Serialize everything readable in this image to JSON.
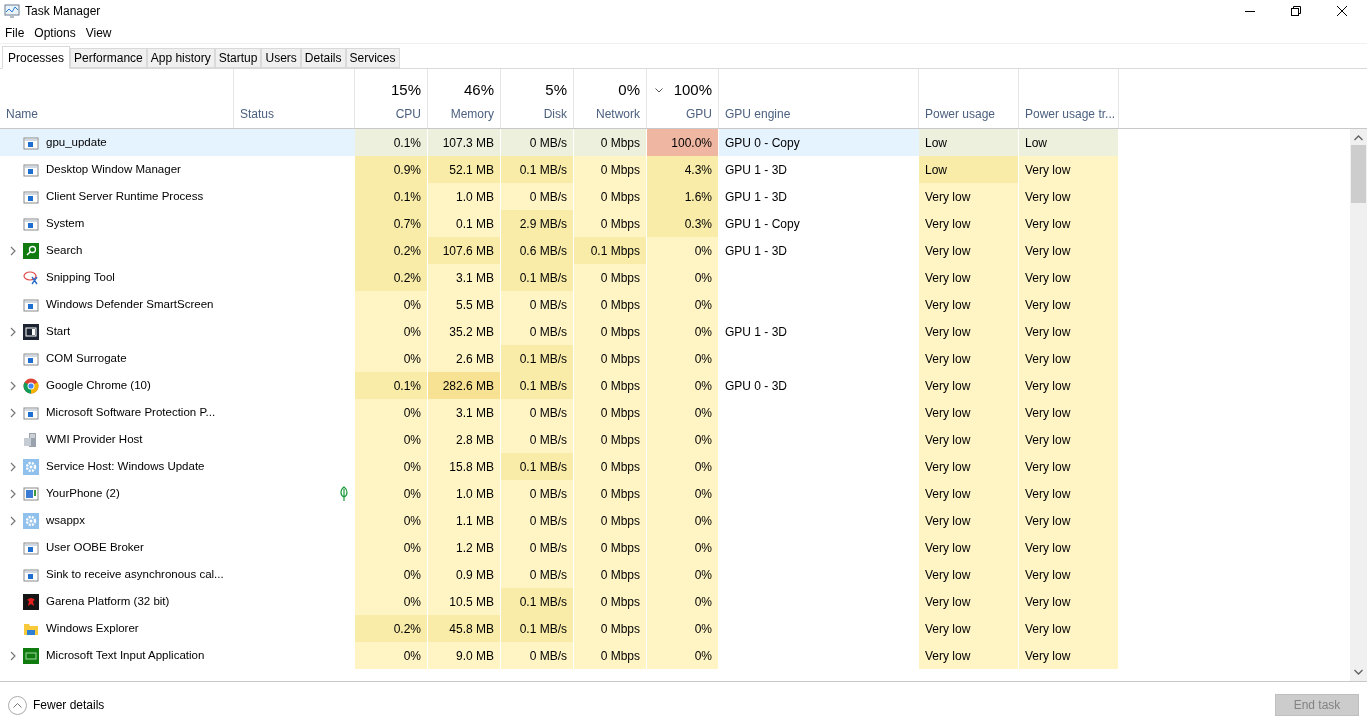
{
  "window": {
    "title": "Task Manager"
  },
  "menu": [
    "File",
    "Options",
    "View"
  ],
  "tabs": [
    {
      "label": "Processes",
      "selected": true
    },
    {
      "label": "Performance",
      "selected": false
    },
    {
      "label": "App history",
      "selected": false
    },
    {
      "label": "Startup",
      "selected": false
    },
    {
      "label": "Users",
      "selected": false
    },
    {
      "label": "Details",
      "selected": false
    },
    {
      "label": "Services",
      "selected": false
    }
  ],
  "table": {
    "columns": [
      {
        "label": "Name",
        "sorted": false
      },
      {
        "label": "Status",
        "sorted": false
      },
      {
        "label": "CPU",
        "summary": "15%",
        "sorted": false
      },
      {
        "label": "Memory",
        "summary": "46%",
        "sorted": false
      },
      {
        "label": "Disk",
        "summary": "5%",
        "sorted": false
      },
      {
        "label": "Network",
        "summary": "0%",
        "sorted": false
      },
      {
        "label": "GPU",
        "summary": "100%",
        "sorted": true
      },
      {
        "label": "GPU engine",
        "sorted": false
      },
      {
        "label": "Power usage",
        "sorted": false
      },
      {
        "label": "Power usage tr...",
        "sorted": false
      }
    ],
    "rows": [
      {
        "kind": "app",
        "expandable": false,
        "selected": true,
        "status_leaf": false,
        "cells": [
          {
            "text": "gpu_update"
          },
          {
            "text": ""
          },
          {
            "text": "0.1%",
            "color": "#edf0dc"
          },
          {
            "text": "107.3 MB",
            "color": "#edf0dc"
          },
          {
            "text": "0 MB/s",
            "color": "#edf0dc"
          },
          {
            "text": "0 Mbps",
            "color": "#edf0dc"
          },
          {
            "text": "100.0%",
            "color": "#efb6a2"
          },
          {
            "text": "GPU 0 - Copy"
          },
          {
            "text": "Low",
            "color": "#edf0dc"
          },
          {
            "text": "Low",
            "color": "#edf0dc"
          }
        ]
      },
      {
        "kind": "app",
        "expandable": false,
        "selected": false,
        "status_leaf": false,
        "cells": [
          {
            "text": "Desktop Window Manager"
          },
          {
            "text": ""
          },
          {
            "text": "0.9%",
            "color": "#f9eca8"
          },
          {
            "text": "52.1 MB",
            "color": "#f9eca8"
          },
          {
            "text": "0.1 MB/s",
            "color": "#f9eca8"
          },
          {
            "text": "0 Mbps",
            "color": "#fff4c4"
          },
          {
            "text": "4.3%",
            "color": "#f9eca8"
          },
          {
            "text": "GPU 1 - 3D"
          },
          {
            "text": "Low",
            "color": "#f9eca8"
          },
          {
            "text": "Very low",
            "color": "#fff4c4"
          }
        ]
      },
      {
        "kind": "app",
        "expandable": false,
        "selected": false,
        "status_leaf": false,
        "cells": [
          {
            "text": "Client Server Runtime Process"
          },
          {
            "text": ""
          },
          {
            "text": "0.1%",
            "color": "#f9eca8"
          },
          {
            "text": "1.0 MB",
            "color": "#fff4c4"
          },
          {
            "text": "0 MB/s",
            "color": "#fff4c4"
          },
          {
            "text": "0 Mbps",
            "color": "#fff4c4"
          },
          {
            "text": "1.6%",
            "color": "#f9eca8"
          },
          {
            "text": "GPU 1 - 3D"
          },
          {
            "text": "Very low",
            "color": "#fff4c4"
          },
          {
            "text": "Very low",
            "color": "#fff4c4"
          }
        ]
      },
      {
        "kind": "app",
        "expandable": false,
        "selected": false,
        "status_leaf": false,
        "cells": [
          {
            "text": "System"
          },
          {
            "text": ""
          },
          {
            "text": "0.7%",
            "color": "#f9eca8"
          },
          {
            "text": "0.1 MB",
            "color": "#fff4c4"
          },
          {
            "text": "2.9 MB/s",
            "color": "#f9eca8"
          },
          {
            "text": "0 Mbps",
            "color": "#fff4c4"
          },
          {
            "text": "0.3%",
            "color": "#f9eca8"
          },
          {
            "text": "GPU 1 - Copy"
          },
          {
            "text": "Very low",
            "color": "#fff4c4"
          },
          {
            "text": "Very low",
            "color": "#fff4c4"
          }
        ]
      },
      {
        "kind": "search",
        "expandable": true,
        "selected": false,
        "status_leaf": false,
        "cells": [
          {
            "text": "Search"
          },
          {
            "text": ""
          },
          {
            "text": "0.2%",
            "color": "#f9eca8"
          },
          {
            "text": "107.6 MB",
            "color": "#f9eca8"
          },
          {
            "text": "0.6 MB/s",
            "color": "#f9eca8"
          },
          {
            "text": "0.1 Mbps",
            "color": "#f9eca8"
          },
          {
            "text": "0%",
            "color": "#fff4c4"
          },
          {
            "text": "GPU 1 - 3D"
          },
          {
            "text": "Very low",
            "color": "#fff4c4"
          },
          {
            "text": "Very low",
            "color": "#fff4c4"
          }
        ]
      },
      {
        "kind": "scissors",
        "expandable": false,
        "selected": false,
        "status_leaf": false,
        "cells": [
          {
            "text": "Snipping Tool"
          },
          {
            "text": ""
          },
          {
            "text": "0.2%",
            "color": "#f9eca8"
          },
          {
            "text": "3.1 MB",
            "color": "#fff4c4"
          },
          {
            "text": "0.1 MB/s",
            "color": "#f9eca8"
          },
          {
            "text": "0 Mbps",
            "color": "#fff4c4"
          },
          {
            "text": "0%",
            "color": "#fff4c4"
          },
          {
            "text": ""
          },
          {
            "text": "Very low",
            "color": "#fff4c4"
          },
          {
            "text": "Very low",
            "color": "#fff4c4"
          }
        ]
      },
      {
        "kind": "app",
        "expandable": false,
        "selected": false,
        "status_leaf": false,
        "cells": [
          {
            "text": "Windows Defender SmartScreen"
          },
          {
            "text": ""
          },
          {
            "text": "0%",
            "color": "#fff4c4"
          },
          {
            "text": "5.5 MB",
            "color": "#fff4c4"
          },
          {
            "text": "0 MB/s",
            "color": "#fff4c4"
          },
          {
            "text": "0 Mbps",
            "color": "#fff4c4"
          },
          {
            "text": "0%",
            "color": "#fff4c4"
          },
          {
            "text": ""
          },
          {
            "text": "Very low",
            "color": "#fff4c4"
          },
          {
            "text": "Very low",
            "color": "#fff4c4"
          }
        ]
      },
      {
        "kind": "start",
        "expandable": true,
        "selected": false,
        "status_leaf": false,
        "cells": [
          {
            "text": "Start"
          },
          {
            "text": ""
          },
          {
            "text": "0%",
            "color": "#fff4c4"
          },
          {
            "text": "35.2 MB",
            "color": "#fff4c4"
          },
          {
            "text": "0 MB/s",
            "color": "#fff4c4"
          },
          {
            "text": "0 Mbps",
            "color": "#fff4c4"
          },
          {
            "text": "0%",
            "color": "#fff4c4"
          },
          {
            "text": "GPU 1 - 3D"
          },
          {
            "text": "Very low",
            "color": "#fff4c4"
          },
          {
            "text": "Very low",
            "color": "#fff4c4"
          }
        ]
      },
      {
        "kind": "app",
        "expandable": false,
        "selected": false,
        "status_leaf": false,
        "cells": [
          {
            "text": "COM Surrogate"
          },
          {
            "text": ""
          },
          {
            "text": "0%",
            "color": "#fff4c4"
          },
          {
            "text": "2.6 MB",
            "color": "#fff4c4"
          },
          {
            "text": "0.1 MB/s",
            "color": "#f9eca8"
          },
          {
            "text": "0 Mbps",
            "color": "#fff4c4"
          },
          {
            "text": "0%",
            "color": "#fff4c4"
          },
          {
            "text": ""
          },
          {
            "text": "Very low",
            "color": "#fff4c4"
          },
          {
            "text": "Very low",
            "color": "#fff4c4"
          }
        ]
      },
      {
        "kind": "chrome",
        "expandable": true,
        "selected": false,
        "status_leaf": false,
        "cells": [
          {
            "text": "Google Chrome (10)"
          },
          {
            "text": ""
          },
          {
            "text": "0.1%",
            "color": "#f9eca8"
          },
          {
            "text": "282.6 MB",
            "color": "#f7e193"
          },
          {
            "text": "0.1 MB/s",
            "color": "#f9eca8"
          },
          {
            "text": "0 Mbps",
            "color": "#fff4c4"
          },
          {
            "text": "0%",
            "color": "#fff4c4"
          },
          {
            "text": "GPU 0 - 3D"
          },
          {
            "text": "Very low",
            "color": "#fff4c4"
          },
          {
            "text": "Very low",
            "color": "#fff4c4"
          }
        ]
      },
      {
        "kind": "app",
        "expandable": true,
        "selected": false,
        "status_leaf": false,
        "cells": [
          {
            "text": "Microsoft Software Protection P..."
          },
          {
            "text": ""
          },
          {
            "text": "0%",
            "color": "#fff4c4"
          },
          {
            "text": "3.1 MB",
            "color": "#fff4c4"
          },
          {
            "text": "0 MB/s",
            "color": "#fff4c4"
          },
          {
            "text": "0 Mbps",
            "color": "#fff4c4"
          },
          {
            "text": "0%",
            "color": "#fff4c4"
          },
          {
            "text": ""
          },
          {
            "text": "Very low",
            "color": "#fff4c4"
          },
          {
            "text": "Very low",
            "color": "#fff4c4"
          }
        ]
      },
      {
        "kind": "wmi",
        "expandable": false,
        "selected": false,
        "status_leaf": false,
        "cells": [
          {
            "text": "WMI Provider Host"
          },
          {
            "text": ""
          },
          {
            "text": "0%",
            "color": "#fff4c4"
          },
          {
            "text": "2.8 MB",
            "color": "#fff4c4"
          },
          {
            "text": "0 MB/s",
            "color": "#fff4c4"
          },
          {
            "text": "0 Mbps",
            "color": "#fff4c4"
          },
          {
            "text": "0%",
            "color": "#fff4c4"
          },
          {
            "text": ""
          },
          {
            "text": "Very low",
            "color": "#fff4c4"
          },
          {
            "text": "Very low",
            "color": "#fff4c4"
          }
        ]
      },
      {
        "kind": "gear",
        "expandable": true,
        "selected": false,
        "status_leaf": false,
        "cells": [
          {
            "text": "Service Host: Windows Update"
          },
          {
            "text": ""
          },
          {
            "text": "0%",
            "color": "#fff4c4"
          },
          {
            "text": "15.8 MB",
            "color": "#fff4c4"
          },
          {
            "text": "0.1 MB/s",
            "color": "#f9eca8"
          },
          {
            "text": "0 Mbps",
            "color": "#fff4c4"
          },
          {
            "text": "0%",
            "color": "#fff4c4"
          },
          {
            "text": ""
          },
          {
            "text": "Very low",
            "color": "#fff4c4"
          },
          {
            "text": "Very low",
            "color": "#fff4c4"
          }
        ]
      },
      {
        "kind": "phone",
        "expandable": true,
        "selected": false,
        "status_leaf": true,
        "cells": [
          {
            "text": "YourPhone (2)"
          },
          {
            "text": ""
          },
          {
            "text": "0%",
            "color": "#fff4c4"
          },
          {
            "text": "1.0 MB",
            "color": "#fff4c4"
          },
          {
            "text": "0 MB/s",
            "color": "#fff4c4"
          },
          {
            "text": "0 Mbps",
            "color": "#fff4c4"
          },
          {
            "text": "0%",
            "color": "#fff4c4"
          },
          {
            "text": ""
          },
          {
            "text": "Very low",
            "color": "#fff4c4"
          },
          {
            "text": "Very low",
            "color": "#fff4c4"
          }
        ]
      },
      {
        "kind": "gear",
        "expandable": true,
        "selected": false,
        "status_leaf": false,
        "cells": [
          {
            "text": "wsappx"
          },
          {
            "text": ""
          },
          {
            "text": "0%",
            "color": "#fff4c4"
          },
          {
            "text": "1.1 MB",
            "color": "#fff4c4"
          },
          {
            "text": "0 MB/s",
            "color": "#fff4c4"
          },
          {
            "text": "0 Mbps",
            "color": "#fff4c4"
          },
          {
            "text": "0%",
            "color": "#fff4c4"
          },
          {
            "text": ""
          },
          {
            "text": "Very low",
            "color": "#fff4c4"
          },
          {
            "text": "Very low",
            "color": "#fff4c4"
          }
        ]
      },
      {
        "kind": "app",
        "expandable": false,
        "selected": false,
        "status_leaf": false,
        "cells": [
          {
            "text": "User OOBE Broker"
          },
          {
            "text": ""
          },
          {
            "text": "0%",
            "color": "#fff4c4"
          },
          {
            "text": "1.2 MB",
            "color": "#fff4c4"
          },
          {
            "text": "0 MB/s",
            "color": "#fff4c4"
          },
          {
            "text": "0 Mbps",
            "color": "#fff4c4"
          },
          {
            "text": "0%",
            "color": "#fff4c4"
          },
          {
            "text": ""
          },
          {
            "text": "Very low",
            "color": "#fff4c4"
          },
          {
            "text": "Very low",
            "color": "#fff4c4"
          }
        ]
      },
      {
        "kind": "app",
        "expandable": false,
        "selected": false,
        "status_leaf": false,
        "cells": [
          {
            "text": "Sink to receive asynchronous cal..."
          },
          {
            "text": ""
          },
          {
            "text": "0%",
            "color": "#fff4c4"
          },
          {
            "text": "0.9 MB",
            "color": "#fff4c4"
          },
          {
            "text": "0 MB/s",
            "color": "#fff4c4"
          },
          {
            "text": "0 Mbps",
            "color": "#fff4c4"
          },
          {
            "text": "0%",
            "color": "#fff4c4"
          },
          {
            "text": ""
          },
          {
            "text": "Very low",
            "color": "#fff4c4"
          },
          {
            "text": "Very low",
            "color": "#fff4c4"
          }
        ]
      },
      {
        "kind": "garena",
        "expandable": false,
        "selected": false,
        "status_leaf": false,
        "cells": [
          {
            "text": "Garena Platform (32 bit)"
          },
          {
            "text": ""
          },
          {
            "text": "0%",
            "color": "#fff4c4"
          },
          {
            "text": "10.5 MB",
            "color": "#fff4c4"
          },
          {
            "text": "0.1 MB/s",
            "color": "#f9eca8"
          },
          {
            "text": "0 Mbps",
            "color": "#fff4c4"
          },
          {
            "text": "0%",
            "color": "#fff4c4"
          },
          {
            "text": ""
          },
          {
            "text": "Very low",
            "color": "#fff4c4"
          },
          {
            "text": "Very low",
            "color": "#fff4c4"
          }
        ]
      },
      {
        "kind": "folder",
        "expandable": false,
        "selected": false,
        "status_leaf": false,
        "cells": [
          {
            "text": "Windows Explorer"
          },
          {
            "text": ""
          },
          {
            "text": "0.2%",
            "color": "#f9eca8"
          },
          {
            "text": "45.8 MB",
            "color": "#f9eca8"
          },
          {
            "text": "0.1 MB/s",
            "color": "#f9eca8"
          },
          {
            "text": "0 Mbps",
            "color": "#fff4c4"
          },
          {
            "text": "0%",
            "color": "#fff4c4"
          },
          {
            "text": ""
          },
          {
            "text": "Very low",
            "color": "#fff4c4"
          },
          {
            "text": "Very low",
            "color": "#fff4c4"
          }
        ]
      },
      {
        "kind": "keyboard",
        "expandable": true,
        "selected": false,
        "status_leaf": false,
        "cells": [
          {
            "text": "Microsoft Text Input Application"
          },
          {
            "text": ""
          },
          {
            "text": "0%",
            "color": "#fff4c4"
          },
          {
            "text": "9.0 MB",
            "color": "#fff4c4"
          },
          {
            "text": "0 MB/s",
            "color": "#fff4c4"
          },
          {
            "text": "0 Mbps",
            "color": "#fff4c4"
          },
          {
            "text": "0%",
            "color": "#fff4c4"
          },
          {
            "text": ""
          },
          {
            "text": "Very low",
            "color": "#fff4c4"
          },
          {
            "text": "Very low",
            "color": "#fff4c4"
          }
        ]
      }
    ]
  },
  "footer": {
    "toggle": "Fewer details",
    "end_task": {
      "label": "End task",
      "disabled": true
    }
  }
}
